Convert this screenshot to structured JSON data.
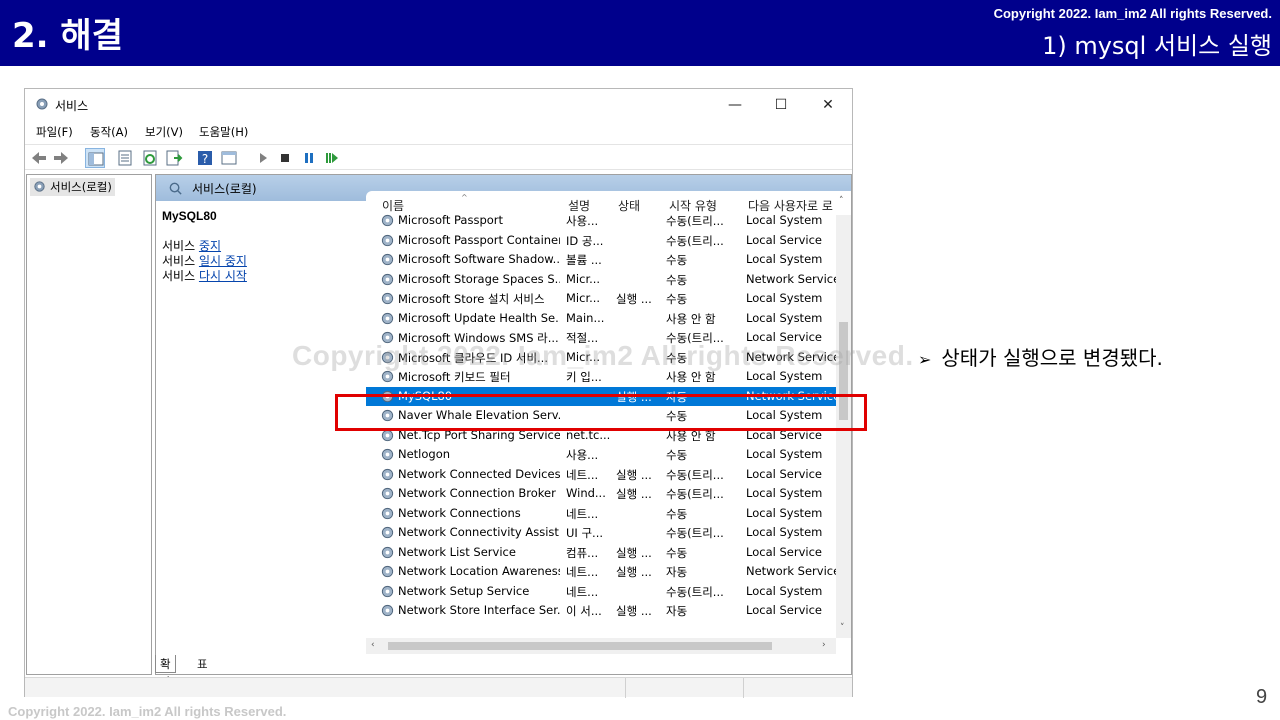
{
  "slide": {
    "title": "2. 해결",
    "copyright_top": "Copyright 2022. Iam_im2 All rights Reserved.",
    "subtitle": "1) mysql 서비스 실행",
    "note": "상태가 실행으로 변경됐다.",
    "watermark": "Copyright 2022. Iam_im2 All rights Reserved.",
    "page_number": "9",
    "copyright_footer": "Copyright 2022. Iam_im2 All rights Reserved.",
    "colors": {
      "header_bg": "#00008c",
      "highlight": "#e00000",
      "selected_row": "#0078d7"
    }
  },
  "window": {
    "title": "서비스",
    "buttons": {
      "minimize": "—",
      "maximize": "☐",
      "close": "✕"
    },
    "menu": [
      "파일(F)",
      "동작(A)",
      "보기(V)",
      "도움말(H)"
    ],
    "tree": {
      "item": "서비스(로컬)"
    },
    "pane_header": "서비스(로컬)",
    "description": {
      "service_name": "MySQL80",
      "actions": [
        {
          "prefix": "서비스 ",
          "link": "중지"
        },
        {
          "prefix": "서비스 ",
          "link": "일시 중지"
        },
        {
          "prefix": "서비스 ",
          "link": "다시 시작"
        }
      ]
    },
    "columns": [
      "이름",
      "설명",
      "상태",
      "시작 유형",
      "다음 사용자로 로"
    ],
    "rows": [
      {
        "name": "Microsoft Passport",
        "desc": "사용...",
        "status": "",
        "start": "수동(트리...",
        "logon": "Local System"
      },
      {
        "name": "Microsoft Passport Container",
        "desc": "ID 공...",
        "status": "",
        "start": "수동(트리...",
        "logon": "Local Service"
      },
      {
        "name": "Microsoft Software Shadow...",
        "desc": "볼륨 ...",
        "status": "",
        "start": "수동",
        "logon": "Local System"
      },
      {
        "name": "Microsoft Storage Spaces S...",
        "desc": "Micr...",
        "status": "",
        "start": "수동",
        "logon": "Network Service"
      },
      {
        "name": "Microsoft Store 설치 서비스",
        "desc": "Micr...",
        "status": "실행 ...",
        "start": "수동",
        "logon": "Local System"
      },
      {
        "name": "Microsoft Update Health Se...",
        "desc": "Main...",
        "status": "",
        "start": "사용 안 함",
        "logon": "Local System"
      },
      {
        "name": "Microsoft Windows SMS 라...",
        "desc": "적절...",
        "status": "",
        "start": "수동(트리...",
        "logon": "Local Service"
      },
      {
        "name": "Microsoft 클라우드 ID 서비...",
        "desc": "Micr...",
        "status": "",
        "start": "수동",
        "logon": "Network Service"
      },
      {
        "name": "Microsoft 키보드 필터",
        "desc": "키 입...",
        "status": "",
        "start": "사용 안 함",
        "logon": "Local System"
      },
      {
        "name": "MySQL80",
        "desc": "",
        "status": "실행 ...",
        "start": "자동",
        "logon": "Network Service",
        "selected": true
      },
      {
        "name": "Naver Whale Elevation Serv...",
        "desc": "",
        "status": "",
        "start": "수동",
        "logon": "Local System"
      },
      {
        "name": "Net.Tcp Port Sharing Service",
        "desc": "net.tc...",
        "status": "",
        "start": "사용 안 함",
        "logon": "Local Service"
      },
      {
        "name": "Netlogon",
        "desc": "사용...",
        "status": "",
        "start": "수동",
        "logon": "Local System"
      },
      {
        "name": "Network Connected Devices...",
        "desc": "네트...",
        "status": "실행 ...",
        "start": "수동(트리...",
        "logon": "Local Service"
      },
      {
        "name": "Network Connection Broker",
        "desc": "Wind...",
        "status": "실행 ...",
        "start": "수동(트리...",
        "logon": "Local System"
      },
      {
        "name": "Network Connections",
        "desc": "네트...",
        "status": "",
        "start": "수동",
        "logon": "Local System"
      },
      {
        "name": "Network Connectivity Assist...",
        "desc": "UI 구...",
        "status": "",
        "start": "수동(트리...",
        "logon": "Local System"
      },
      {
        "name": "Network List Service",
        "desc": "컴퓨...",
        "status": "실행 ...",
        "start": "수동",
        "logon": "Local Service"
      },
      {
        "name": "Network Location Awareness",
        "desc": "네트...",
        "status": "실행 ...",
        "start": "자동",
        "logon": "Network Service"
      },
      {
        "name": "Network Setup Service",
        "desc": "네트...",
        "status": "",
        "start": "수동(트리...",
        "logon": "Local System"
      },
      {
        "name": "Network Store Interface Ser...",
        "desc": "이 서...",
        "status": "실행 ...",
        "start": "자동",
        "logon": "Local Service"
      }
    ],
    "tabs": {
      "extended": "확장",
      "standard": "표준"
    },
    "icons": [
      "gear-icon",
      "back-arrow-icon",
      "forward-arrow-icon",
      "play-icon",
      "stop-icon",
      "pause-icon",
      "resume-icon",
      "help-icon"
    ]
  }
}
